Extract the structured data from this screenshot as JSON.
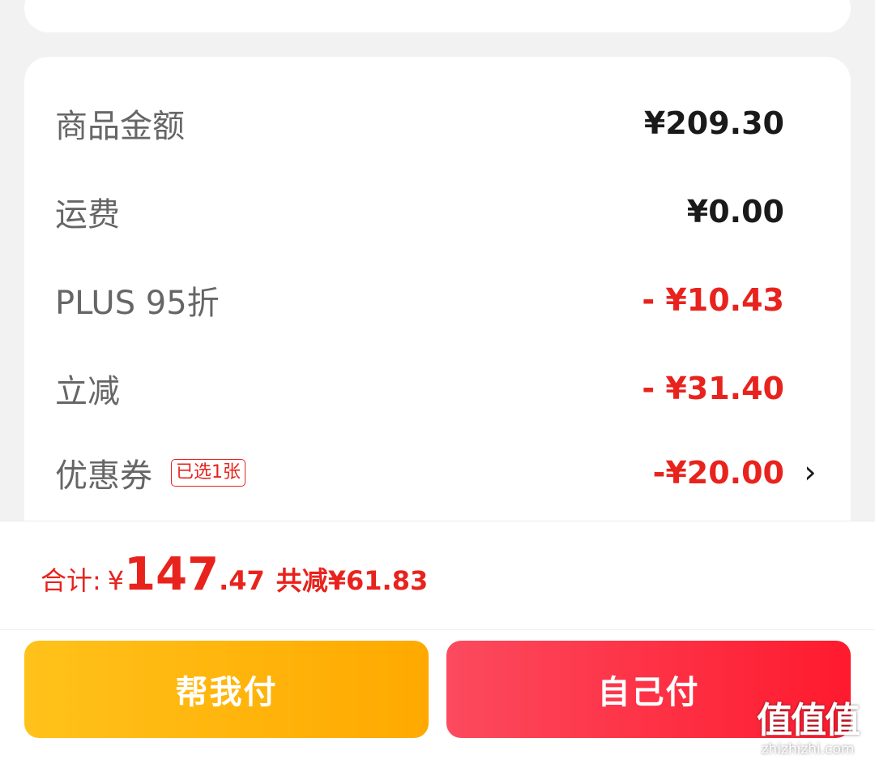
{
  "price_rows": [
    {
      "label": "商品金额",
      "amount": "¥209.30"
    },
    {
      "label": "运费",
      "amount": "¥0.00"
    },
    {
      "label": "PLUS 95折",
      "amount": "- ¥10.43"
    },
    {
      "label": "立减",
      "amount": "- ¥31.40"
    },
    {
      "label": "优惠券",
      "badge": "已选1张",
      "amount": "-¥20.00",
      "chevron": "›"
    }
  ],
  "total": {
    "label": "合计:",
    "currency_symbol": "¥",
    "amount_int": "147",
    "amount_dec": ".47",
    "saved_text": "共减¥61.83"
  },
  "actions": {
    "help_pay_label": "帮我付",
    "self_pay_label": "自己付"
  },
  "watermark": {
    "logo_text": "值值值",
    "site_text": "zhizhizhi.com"
  },
  "colors": {
    "discount_red": "#e8231d",
    "help_button": "#ffb30f",
    "self_button": "#ff3347"
  }
}
